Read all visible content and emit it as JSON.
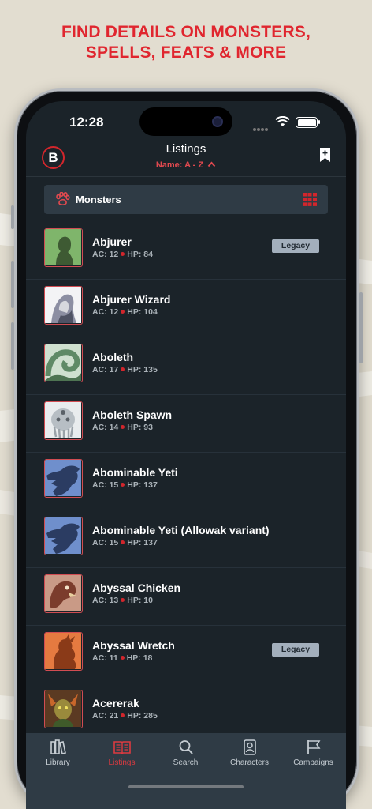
{
  "promo": {
    "line1": "FIND DETAILS ON MONSTERS,",
    "line2": "SPELLS, FEATS & MORE"
  },
  "status_bar": {
    "time": "12:28"
  },
  "nav": {
    "logo_letter": "B",
    "title": "Listings",
    "sort_label": "Name: A - Z"
  },
  "filter": {
    "label": "Monsters"
  },
  "colors": {
    "accent": "#d2262c",
    "background": "#1b2329",
    "panel": "#2f3b45",
    "legacy_badge": "#a3afbc"
  },
  "listings": [
    {
      "name": "Abjurer",
      "ac": "AC: 12",
      "hp": "HP: 84",
      "badge": "Legacy",
      "thumb": "abjurer-portrait"
    },
    {
      "name": "Abjurer Wizard",
      "ac": "AC: 12",
      "hp": "HP: 104",
      "badge": "",
      "thumb": "abjurer-wizard-portrait"
    },
    {
      "name": "Aboleth",
      "ac": "AC: 17",
      "hp": "HP: 135",
      "badge": "",
      "thumb": "aboleth-portrait"
    },
    {
      "name": "Aboleth Spawn",
      "ac": "AC: 14",
      "hp": "HP: 93",
      "badge": "",
      "thumb": "aboleth-spawn-portrait"
    },
    {
      "name": "Abominable Yeti",
      "ac": "AC: 15",
      "hp": "HP: 137",
      "badge": "",
      "thumb": "yeti-silhouette"
    },
    {
      "name": "Abominable Yeti (Allowak variant)",
      "ac": "AC: 15",
      "hp": "HP: 137",
      "badge": "",
      "thumb": "yeti-silhouette"
    },
    {
      "name": "Abyssal Chicken",
      "ac": "AC: 13",
      "hp": "HP: 10",
      "badge": "",
      "thumb": "abyssal-chicken-portrait"
    },
    {
      "name": "Abyssal Wretch",
      "ac": "AC: 11",
      "hp": "HP: 18",
      "badge": "Legacy",
      "thumb": "abyssal-wretch-silhouette"
    },
    {
      "name": "Acererak",
      "ac": "AC: 21",
      "hp": "HP: 285",
      "badge": "",
      "thumb": "acererak-portrait"
    }
  ],
  "tabs": [
    {
      "label": "Library",
      "icon": "books-icon",
      "active": false
    },
    {
      "label": "Listings",
      "icon": "open-book-icon",
      "active": true
    },
    {
      "label": "Search",
      "icon": "search-icon",
      "active": false
    },
    {
      "label": "Characters",
      "icon": "character-icon",
      "active": false
    },
    {
      "label": "Campaigns",
      "icon": "flag-icon",
      "active": false
    }
  ]
}
